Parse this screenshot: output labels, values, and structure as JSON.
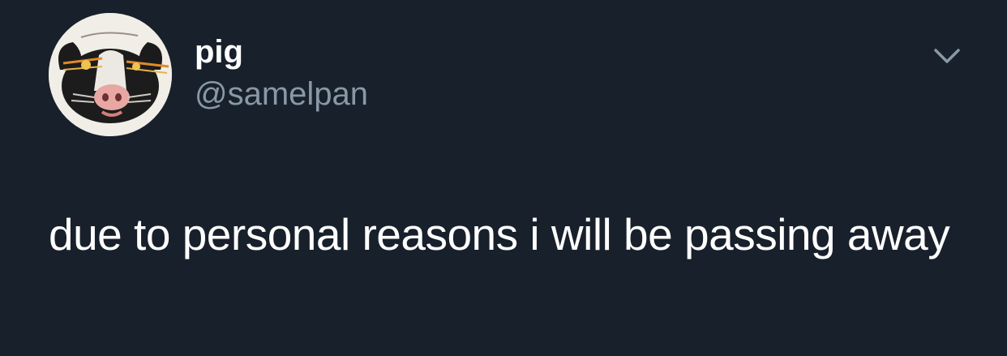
{
  "theme": {
    "background": "#18202b",
    "text_primary": "#ffffff",
    "text_secondary": "#8899a6",
    "chevron_color": "#8899a6"
  },
  "tweet": {
    "author": {
      "display_name": "pig",
      "handle": "@samelpan",
      "avatar_icon": "pig-face-avatar"
    },
    "menu_icon": "chevron-down-icon",
    "text": "due to personal reasons i will be passing away"
  }
}
